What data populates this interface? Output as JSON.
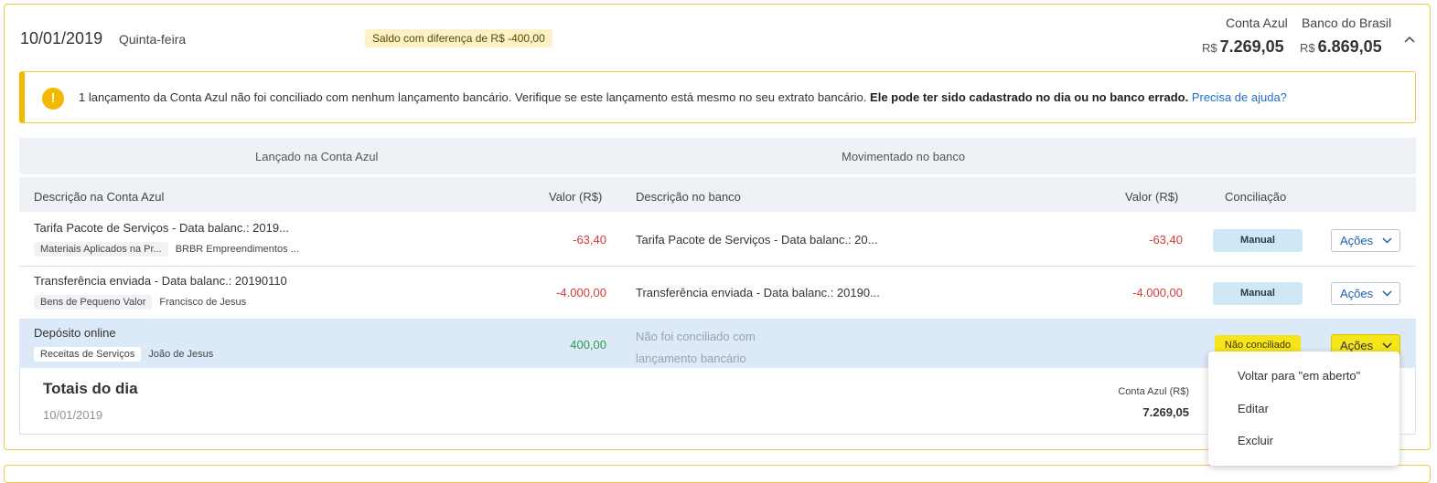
{
  "day": {
    "date": "10/01/2019",
    "weekday": "Quinta-feira",
    "diff_badge": "Saldo com diferença de R$ -400,00",
    "balances": [
      {
        "label": "Conta Azul",
        "currency": "R$",
        "value": "7.269,05"
      },
      {
        "label": "Banco do Brasil",
        "currency": "R$",
        "value": "6.869,05"
      }
    ],
    "collapse_icon": "chevron-up-icon"
  },
  "alert": {
    "icon": "!",
    "text": "1 lançamento da Conta Azul não foi conciliado com nenhum lançamento bancário. Verifique se este lançamento está mesmo no seu extrato bancário.",
    "bold": "Ele pode ter sido cadastrado no dia ou no banco errado.",
    "link": "Precisa de ajuda?"
  },
  "table": {
    "group_left": "Lançado na Conta Azul",
    "group_right": "Movimentado no banco",
    "columns": [
      "Descrição na Conta Azul",
      "Valor (R$)",
      "Descrição no banco",
      "Valor (R$)",
      "Conciliação"
    ],
    "rows": [
      {
        "description": "Tarifa Pacote de Serviços - Data balanc.: 2019...",
        "category": "Materiais Aplicados na Pr...",
        "contact": "BRBR Empreendimentos ...",
        "value": "-63,40",
        "bank_description": "Tarifa Pacote de Serviços - Data balanc.: 20...",
        "bank_value": "-63,40",
        "status": "Manual",
        "actions": "Ações"
      },
      {
        "description": "Transferência enviada - Data balanc.: 20190110",
        "category": "Bens de Pequeno Valor",
        "contact": "Francisco de Jesus",
        "value": "-4.000,00",
        "bank_description": "Transferência enviada - Data balanc.: 20190...",
        "bank_value": "-4.000,00",
        "status": "Manual",
        "actions": "Ações"
      },
      {
        "description": "Depósito online",
        "category": "Receitas de Serviços",
        "contact": "João de Jesus",
        "value": "400,00",
        "bank_none_1": "Não foi conciliado com",
        "bank_none_2": "lançamento bancário",
        "status": "Não conciliado",
        "actions": "Ações"
      }
    ]
  },
  "totals": {
    "title": "Totais do dia",
    "date": "10/01/2019",
    "label": "Conta Azul (R$)",
    "value": "7.269,05"
  },
  "dropdown": {
    "items": [
      "Voltar para \"em aberto\"",
      "Editar",
      "Excluir"
    ]
  },
  "colors": {
    "accent_border": "#f5c64a",
    "negative": "#d63a3a",
    "positive": "#2e9b4a",
    "highlight": "#f5e51a",
    "link": "#1f6fcf"
  }
}
